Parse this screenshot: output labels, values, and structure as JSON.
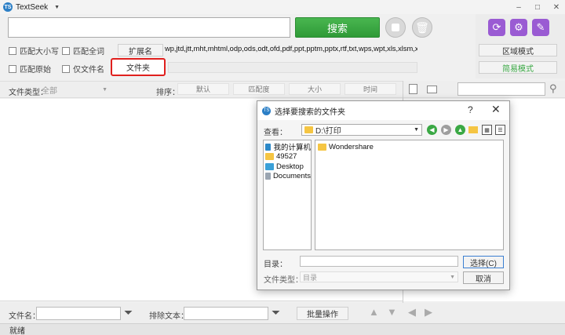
{
  "app": {
    "title": "TextSeek",
    "logo_text": "TS",
    "menu_arrow": "▼"
  },
  "window": {
    "minimize": "–",
    "maximize": "□",
    "close": "✕"
  },
  "search": {
    "button_label": "搜索",
    "query": ""
  },
  "options": {
    "match_case": "匹配大小写",
    "match_whole_word": "匹配全词",
    "match_original": "匹配原始",
    "filename_only": "仅文件名"
  },
  "extension": {
    "button_label": "扩展名",
    "list": "wp,jtd,jtt,mht,mhtml,odp,ods,odt,ofd,pdf,ppt,pptm,pptx,rtf,txt,wps,wpt,xls,xlsm,xlsx,xml"
  },
  "folder": {
    "button_label": "文件夹"
  },
  "modes": {
    "area_mode": "区域模式",
    "simple_mode": "简易模式"
  },
  "filters": {
    "file_type_label": "文件类型：",
    "file_type_value": "全部",
    "sort_label": "排序：",
    "sort_options": [
      "默认",
      "匹配度",
      "大小",
      "时间"
    ]
  },
  "bottom": {
    "filename_label": "文件名：",
    "exclude_label": "排除文本：",
    "batch_button": "批量操作"
  },
  "status": {
    "text": "就绪"
  },
  "dialog": {
    "logo_text": "TS",
    "title": "选择要搜索的文件夹",
    "help": "?",
    "close": "✕",
    "look_in_label": "查看：",
    "look_in_value": "D:\\打印",
    "places": [
      "我的计算机",
      "49527",
      "Desktop",
      "Documents"
    ],
    "files": [
      "Wondershare"
    ],
    "dir_label": "目录：",
    "dir_value": "",
    "type_label": "文件类型：",
    "type_value": "目录",
    "select_button": "选择(C)",
    "cancel_button": "取消"
  },
  "colors": {
    "accent_green": "#3aa844",
    "highlight_red": "#e0201e",
    "tool_purple": "#9a5bd3"
  }
}
